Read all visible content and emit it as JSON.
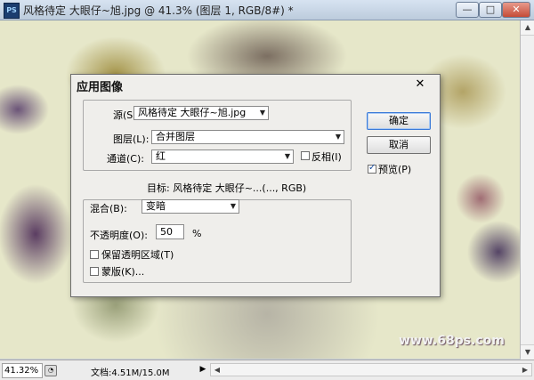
{
  "window": {
    "title": "风格待定 大眼仔~旭.jpg @ 41.3% (图层 1, RGB/8#) *",
    "app_icon": "PS",
    "controls": {
      "minimize": "—",
      "maximize": "□",
      "close": "✕"
    }
  },
  "canvas": {
    "watermark": "www.68ps.com"
  },
  "status": {
    "zoom": "41.32%",
    "doc_info": "文档:4.51M/15.0M",
    "arrow": "▶"
  },
  "dialog": {
    "title": "应用图像",
    "close": "✕",
    "source": {
      "label": "源(S):",
      "value": "风格待定 大眼仔~旭.jpg"
    },
    "layer": {
      "label": "图层(L):",
      "value": "合并图层"
    },
    "channel": {
      "label": "通道(C):",
      "value": "红"
    },
    "invert": {
      "label": "反相(I)",
      "checked": false
    },
    "target": "目标:  风格待定 大眼仔~...(..., RGB)",
    "blending": {
      "label": "混合(B):",
      "value": "变暗"
    },
    "opacity": {
      "label": "不透明度(O):",
      "value": "50",
      "unit": "%"
    },
    "preserve_transparency": {
      "label": "保留透明区域(T)",
      "checked": false
    },
    "mask": {
      "label": "蒙版(K)...",
      "checked": false
    },
    "ok_label": "确定",
    "cancel_label": "取消",
    "preview": {
      "label": "预览(P)",
      "checked": true
    },
    "combo_arrow": "▼"
  }
}
